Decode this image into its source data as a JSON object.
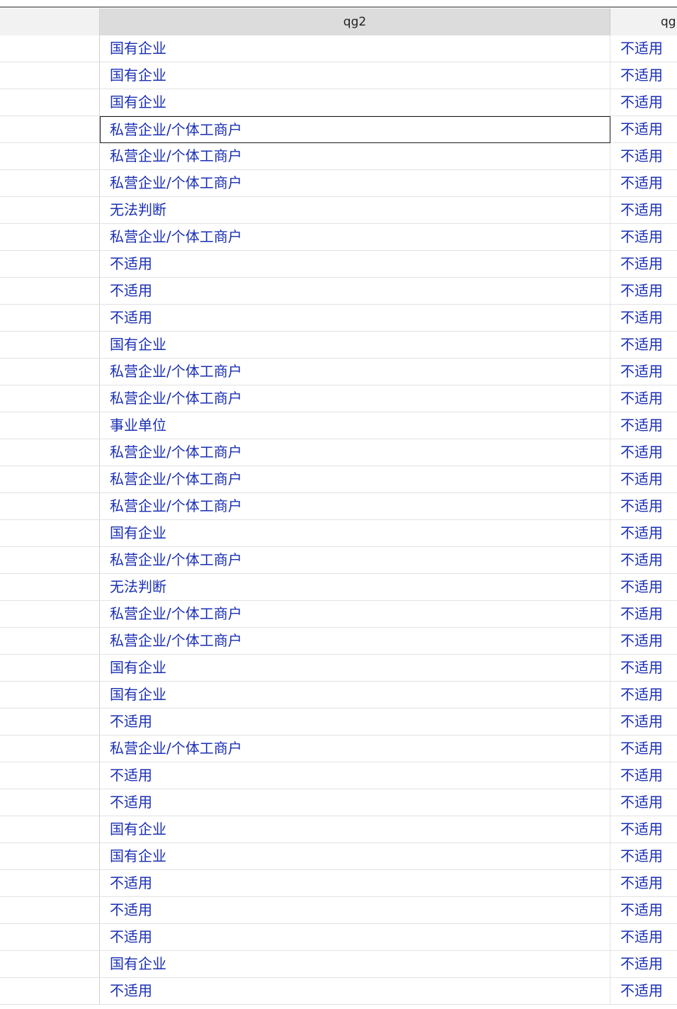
{
  "grid": {
    "columns": [
      "",
      "qg2",
      "qg"
    ],
    "rows": [
      {
        "qg2": "国有企业",
        "qg": "不适用"
      },
      {
        "qg2": "国有企业",
        "qg": "不适用"
      },
      {
        "qg2": "国有企业",
        "qg": "不适用"
      },
      {
        "qg2": "私营企业/个体工商户",
        "qg": "不适用"
      },
      {
        "qg2": "私营企业/个体工商户",
        "qg": "不适用"
      },
      {
        "qg2": "私营企业/个体工商户",
        "qg": "不适用"
      },
      {
        "qg2": "无法判断",
        "qg": "不适用"
      },
      {
        "qg2": "私营企业/个体工商户",
        "qg": "不适用"
      },
      {
        "qg2": "不适用",
        "qg": "不适用"
      },
      {
        "qg2": "不适用",
        "qg": "不适用"
      },
      {
        "qg2": "不适用",
        "qg": "不适用"
      },
      {
        "qg2": "国有企业",
        "qg": "不适用"
      },
      {
        "qg2": "私营企业/个体工商户",
        "qg": "不适用"
      },
      {
        "qg2": "私营企业/个体工商户",
        "qg": "不适用"
      },
      {
        "qg2": "事业单位",
        "qg": "不适用"
      },
      {
        "qg2": "私营企业/个体工商户",
        "qg": "不适用"
      },
      {
        "qg2": "私营企业/个体工商户",
        "qg": "不适用"
      },
      {
        "qg2": "私营企业/个体工商户",
        "qg": "不适用"
      },
      {
        "qg2": "国有企业",
        "qg": "不适用"
      },
      {
        "qg2": "私营企业/个体工商户",
        "qg": "不适用"
      },
      {
        "qg2": "无法判断",
        "qg": "不适用"
      },
      {
        "qg2": "私营企业/个体工商户",
        "qg": "不适用"
      },
      {
        "qg2": "私营企业/个体工商户",
        "qg": "不适用"
      },
      {
        "qg2": "国有企业",
        "qg": "不适用"
      },
      {
        "qg2": "国有企业",
        "qg": "不适用"
      },
      {
        "qg2": "不适用",
        "qg": "不适用"
      },
      {
        "qg2": "私营企业/个体工商户",
        "qg": "不适用"
      },
      {
        "qg2": "不适用",
        "qg": "不适用"
      },
      {
        "qg2": "不适用",
        "qg": "不适用"
      },
      {
        "qg2": "国有企业",
        "qg": "不适用"
      },
      {
        "qg2": "国有企业",
        "qg": "不适用"
      },
      {
        "qg2": "不适用",
        "qg": "不适用"
      },
      {
        "qg2": "不适用",
        "qg": "不适用"
      },
      {
        "qg2": "不适用",
        "qg": "不适用"
      },
      {
        "qg2": "国有企业",
        "qg": "不适用"
      },
      {
        "qg2": "不适用",
        "qg": "不适用"
      }
    ],
    "selected_row": 3,
    "colors": {
      "cell_text": "#1a2fb4",
      "header_text": "#222222",
      "selected_header_bg": "#dcdcdc"
    }
  }
}
